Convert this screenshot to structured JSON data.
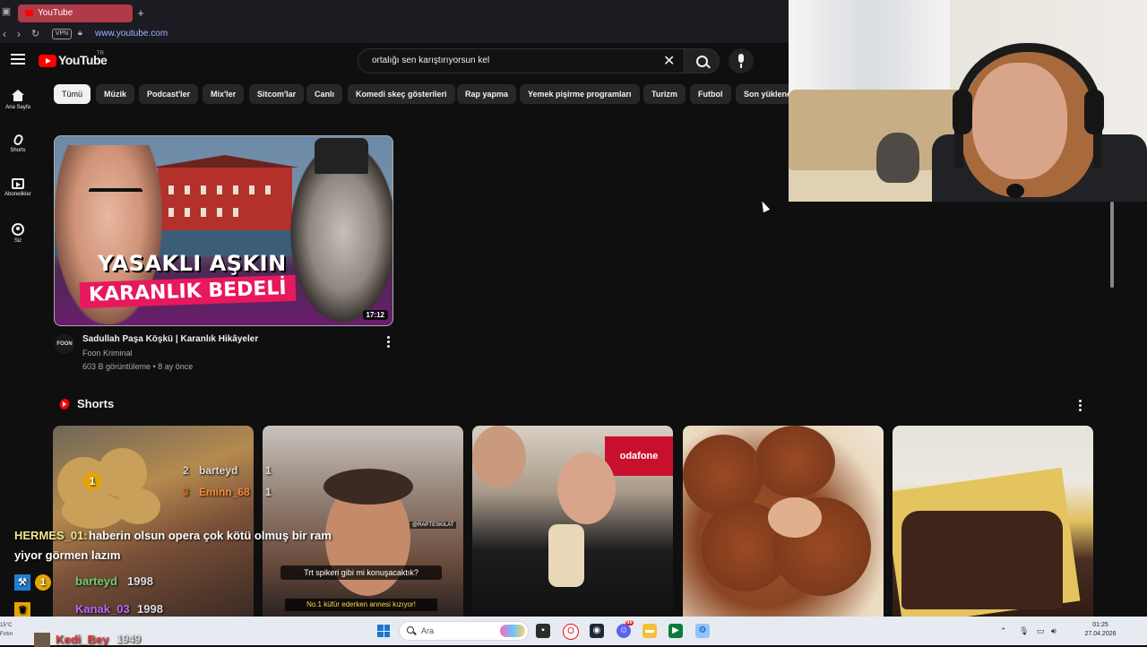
{
  "browser": {
    "tab_title": "YouTube",
    "url": "www.youtube.com",
    "vpn_label": "VPN",
    "new_tab": "+"
  },
  "youtube": {
    "logo_text": "YouTube",
    "country_code": "TR",
    "search_query": "ortalığı sen karıştırıyorsun kel",
    "guide": [
      {
        "label": "Ana Sayfa",
        "icon": "home-icon"
      },
      {
        "label": "Shorts",
        "icon": "shorts-icon"
      },
      {
        "label": "Abonelikler",
        "icon": "subscriptions-icon"
      },
      {
        "label": "Siz",
        "icon": "you-icon"
      }
    ],
    "chips": [
      "Tümü",
      "Müzik",
      "Podcast'ler",
      "Mix'ler",
      "Sitcom'lar",
      "Canlı",
      "Komedi skeç gösterileri",
      "Rap yapma",
      "Yemek pişirme programları",
      "Turizm",
      "Futbol",
      "Son yüklene"
    ],
    "video": {
      "thumb_line1": "YASAKLI AŞKIN",
      "thumb_line2": "KARANLIK BEDELİ",
      "duration": "17:12",
      "title": "Sadullah Paşa Köşkü | Karanlık Hikâyeler",
      "channel": "Foon Kriminal",
      "meta": "603 B görüntüleme • 8 ay önce",
      "avatar_text": "FOON"
    },
    "shorts": {
      "title": "Shorts",
      "items": [
        {
          "caption": "",
          "subcaption": ""
        },
        {
          "caption": "Trt spikeri gibi mi konuşacaktık?",
          "subcaption": "No.1 küfür ederken annesi kızıyor!",
          "handle": "@RAPTESKILAT"
        },
        {
          "caption": "",
          "subcaption": "",
          "sign": "odafone"
        },
        {
          "caption": "",
          "subcaption": ""
        },
        {
          "caption": "",
          "subcaption": ""
        }
      ]
    }
  },
  "chat_overlay": {
    "leaderboard": [
      {
        "rank": "2",
        "name": "barteyd",
        "value": "1"
      },
      {
        "rank": "3",
        "name": "Eminn_68",
        "value": "1"
      }
    ],
    "rank1_badge": "1",
    "message_user": "HERMES_01:",
    "message_line1": "haberin olsun opera çok kötü olmuş bir ram",
    "message_line2": "yiyor görmen lazım",
    "bottom_rows": [
      {
        "badge": "1",
        "name": "barteyd",
        "score": "1998"
      },
      {
        "badge": "",
        "name": "Kanak_03",
        "score": "1998"
      },
      {
        "badge": "",
        "name": "Kedi_Bey",
        "score": "1949"
      }
    ]
  },
  "taskbar": {
    "search_placeholder": "Ara",
    "time": "01:25",
    "date": "27.04.2026",
    "weather_temp": "15°C",
    "weather_desc": "Fırtın",
    "notification_count": "99"
  }
}
